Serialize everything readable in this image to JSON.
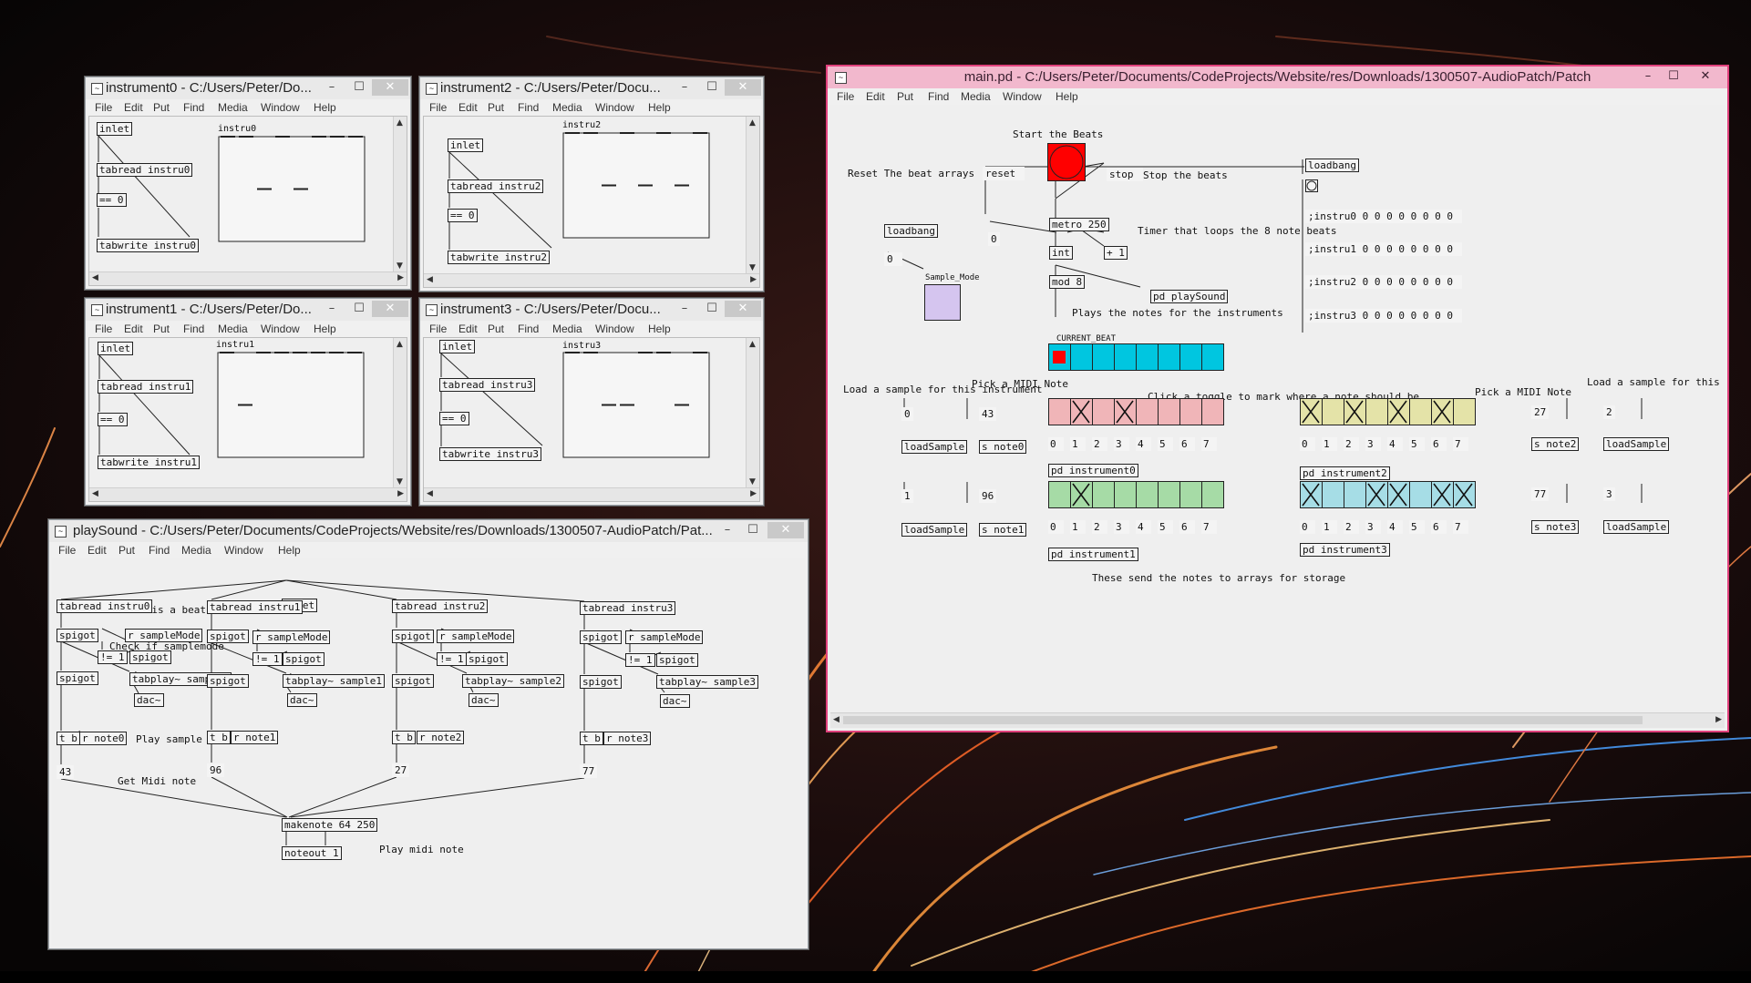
{
  "colors": {
    "accent": "#e0417c",
    "bang": "#ff0000",
    "toggle_purple": "#d5c5ef",
    "beat_cell": "#00c6e0",
    "beat_active": "#ff0000",
    "row_pink": "#f0b5b8",
    "row_yellow": "#e4e3a8",
    "row_green": "#a6dba6",
    "row_blue": "#a6dde6"
  },
  "menu": [
    "File",
    "Edit",
    "Put",
    "Find",
    "Media",
    "Window",
    "Help"
  ],
  "window_controls": {
    "minimize": "–",
    "maximize": "☐",
    "close": "✕"
  },
  "instrument_windows": [
    {
      "title": "instrument0 - C:/Users/Peter/Do...",
      "array": "instru0",
      "objects": [
        "inlet",
        "tabread instru0",
        "== 0",
        "tabwrite instru0"
      ],
      "values": [
        1,
        1,
        0,
        1,
        0,
        1,
        1,
        1
      ]
    },
    {
      "title": "instrument2 - C:/Users/Peter/Docu...",
      "array": "instru2",
      "objects": [
        "inlet",
        "tabread instru2",
        "== 0",
        "tabwrite instru2"
      ],
      "values": [
        1,
        1,
        0,
        1,
        0,
        1,
        0,
        1
      ]
    },
    {
      "title": "instrument1 - C:/Users/Peter/Do...",
      "array": "instru1",
      "objects": [
        "inlet",
        "tabread instru1",
        "== 0",
        "tabwrite instru1"
      ],
      "values": [
        1,
        0,
        1,
        1,
        1,
        1,
        1,
        1
      ]
    },
    {
      "title": "instrument3 - C:/Users/Peter/Docu...",
      "array": "instru3",
      "objects": [
        "inlet",
        "tabread instru3",
        "== 0",
        "tabwrite instru3"
      ],
      "values": [
        1,
        1,
        0,
        0,
        1,
        1,
        0,
        1
      ]
    }
  ],
  "playsound": {
    "title": "playSound - C:/Users/Peter/Documents/CodeProjects/Website/res/Downloads/1300507-AudioPatch/Pat...",
    "comments": {
      "check_beat": "Check if there is a beat",
      "check_samplemode": "Check if samplemode",
      "play_sample": "Play sample",
      "get_midi": "Get Midi note",
      "play_midi": "Play midi note"
    },
    "inlet": "inlet",
    "columns": [
      {
        "tabread": "tabread instru0",
        "spigot": "spigot",
        "r_mode": "r sampleMode",
        "neq": "!= 1",
        "spigot2": "spigot",
        "spigot3": "spigot",
        "tabplay": "tabplay~ sample0",
        "dac": "dac~",
        "tb": "t b",
        "rnote": "r note0",
        "num": "43"
      },
      {
        "tabread": "tabread instru1",
        "spigot": "spigot",
        "r_mode": "r sampleMode",
        "neq": "!= 1",
        "spigot2": "spigot",
        "spigot3": "spigot",
        "tabplay": "tabplay~ sample1",
        "dac": "dac~",
        "tb": "t b",
        "rnote": "r note1",
        "num": "96"
      },
      {
        "tabread": "tabread instru2",
        "spigot": "spigot",
        "r_mode": "r sampleMode",
        "neq": "!= 1",
        "spigot2": "spigot",
        "spigot3": "spigot",
        "tabplay": "tabplay~ sample2",
        "dac": "dac~",
        "tb": "t b",
        "rnote": "r note2",
        "num": "27"
      },
      {
        "tabread": "tabread instru3",
        "spigot": "spigot",
        "r_mode": "r sampleMode",
        "neq": "!= 1",
        "spigot2": "spigot",
        "spigot3": "spigot",
        "tabplay": "tabplay~ sample3",
        "dac": "dac~",
        "tb": "t b",
        "rnote": "r note3",
        "num": "77"
      }
    ],
    "makenote": "makenote 64 250",
    "noteout": "noteout 1"
  },
  "main": {
    "title": "main.pd - C:/Users/Peter/Documents/CodeProjects/Website/res/Downloads/1300507-AudioPatch/Patch",
    "comments": {
      "start": "Start the Beats",
      "reset_arrays": "Reset The beat arrays",
      "stop_beats": "Stop the beats",
      "timer": "Timer that loops the 8 note beats",
      "plays_notes": "Plays the notes for the instruments",
      "load_sample_left": "Load a sample for this instrument",
      "pick_midi_left": "Pick a MIDI Note",
      "click_toggle": "Click a toggle to mark where a note should be",
      "pick_midi_right": "Pick a MIDI Note",
      "load_sample_right": "Load a sample for this",
      "send_notes": "These send the notes to arrays for storage"
    },
    "labels": {
      "sample_mode": "Sample_Mode",
      "current_beat": "CURRENT_BEAT"
    },
    "objects": {
      "reset": "reset",
      "stop": "stop",
      "loadbang_top": "loadbang",
      "loadbang_left": "loadbang",
      "metro": "metro 250",
      "zero_num": "0",
      "zero_msg": "0",
      "int": "int",
      "plus1": "+ 1",
      "mod8": "mod 8",
      "pd_playsound": "pd playSound"
    },
    "array_messages": [
      ";instru0 0 0 0 0 0 0 0 0",
      ";instru1 0 0 0 0 0 0 0 0",
      ";instru2 0 0 0 0 0 0 0 0",
      ";instru3 0 0 0 0 0 0 0 0"
    ],
    "current_beat": 0,
    "beat_count": 8,
    "rows": [
      {
        "instrument": "pd instrument0",
        "sample_num": "0",
        "load": "loadSample",
        "note_num": "43",
        "send": "s note0",
        "toggles": [
          0,
          1,
          0,
          1,
          0,
          0,
          0,
          0
        ],
        "color_key": "row_pink",
        "side": "left"
      },
      {
        "instrument": "pd instrument2",
        "sample_num": "2",
        "load": "loadSample",
        "note_num": "27",
        "send": "s note2",
        "toggles": [
          1,
          0,
          1,
          0,
          1,
          0,
          1,
          0
        ],
        "color_key": "row_yellow",
        "side": "right"
      },
      {
        "instrument": "pd instrument1",
        "sample_num": "1",
        "load": "loadSample",
        "note_num": "96",
        "send": "s note1",
        "toggles": [
          0,
          1,
          0,
          0,
          0,
          0,
          0,
          0
        ],
        "color_key": "row_green",
        "side": "left"
      },
      {
        "instrument": "pd instrument3",
        "sample_num": "3",
        "load": "loadSample",
        "note_num": "77",
        "send": "s note3",
        "toggles": [
          1,
          0,
          0,
          1,
          1,
          0,
          1,
          1
        ],
        "color_key": "row_blue",
        "side": "right"
      }
    ],
    "index_messages": [
      "0",
      "1",
      "2",
      "3",
      "4",
      "5",
      "6",
      "7"
    ]
  }
}
